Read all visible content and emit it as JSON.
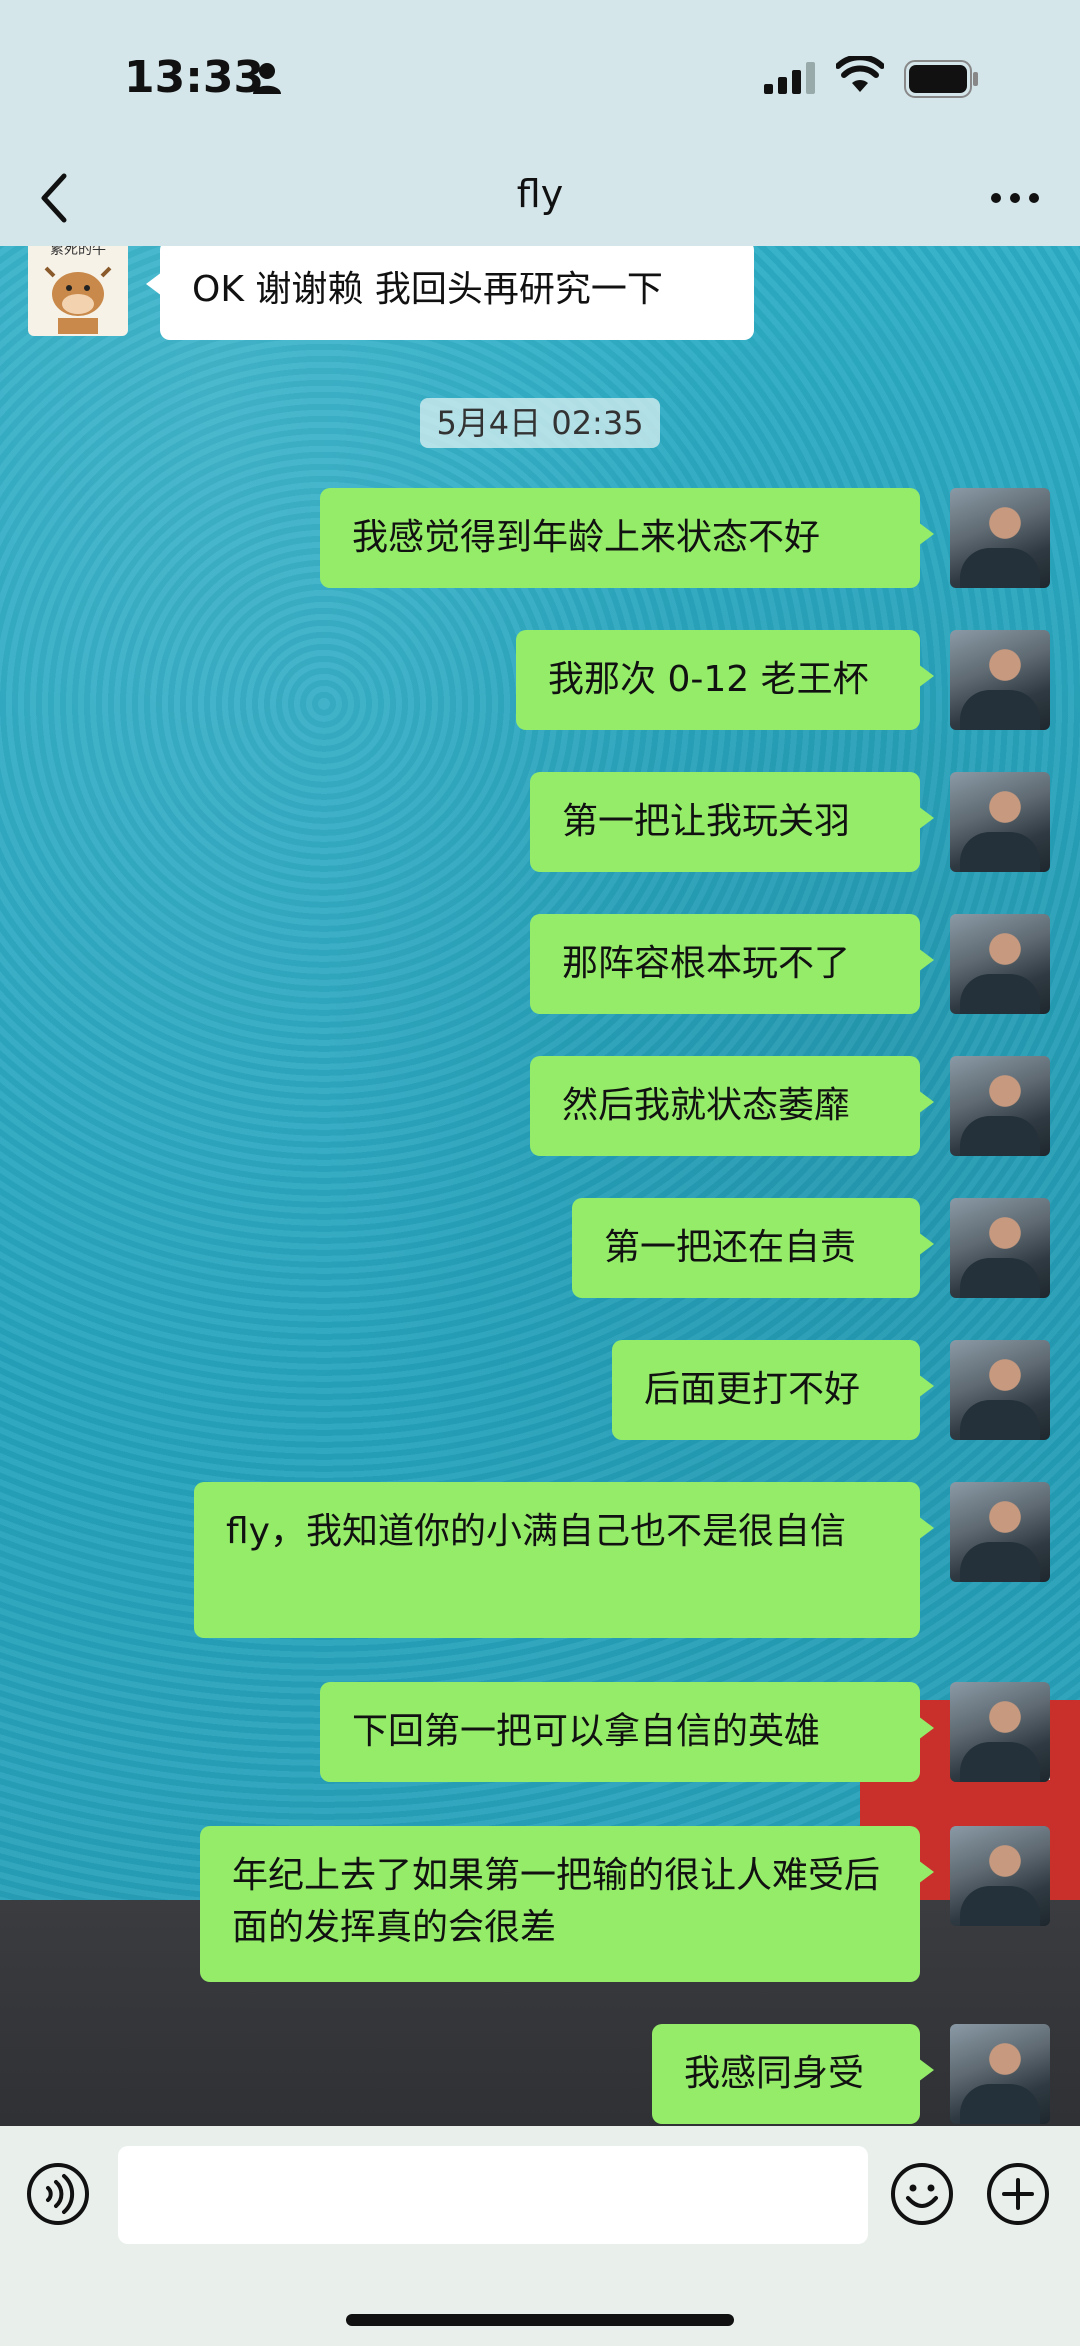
{
  "status_bar": {
    "time": "13:33"
  },
  "header": {
    "title": "fly"
  },
  "incoming": {
    "avatar_text": "累死的牛",
    "text": "OK 谢谢赖 我回头再研究一下"
  },
  "timestamp": "5月4日 02:35",
  "messages": [
    "我感觉得到年龄上来状态不好",
    "我那次 0-12 老王杯",
    "第一把让我玩关羽",
    "那阵容根本玩不了",
    "然后我就状态萎靡",
    "第一把还在自责",
    "后面更打不好",
    "fly，我知道你的小满自己也不是很自信",
    "下回第一把可以拿自信的英雄",
    "年纪上去了如果第一把输的很让人难受后面的发挥真的会很差",
    "我感同身受"
  ],
  "input": {
    "value": ""
  },
  "colors": {
    "outgoing_bubble": "#95ec69",
    "incoming_bubble": "#ffffff",
    "chat_background": "#2aa9c3",
    "header_background": "#d4e6ea"
  },
  "icons": [
    "person-icon",
    "signal-icon",
    "wifi-icon",
    "battery-icon",
    "back-icon",
    "more-icon",
    "voice-icon",
    "emoji-icon",
    "plus-icon"
  ]
}
